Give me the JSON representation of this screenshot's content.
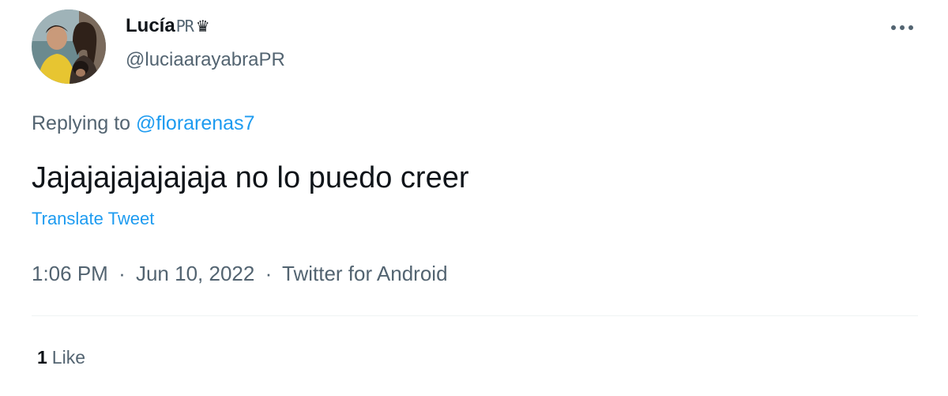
{
  "author": {
    "display_name": "Lucía",
    "name_suffix": "PR",
    "crown_glyph": "♛",
    "handle": "@luciaarayabraPR",
    "avatar_icon": "profile-photo"
  },
  "more_icon": "more-dots-icon",
  "reply": {
    "prefix": "Replying to",
    "mention": "@florarenas7"
  },
  "tweet_text": "Jajajajajajajaja no lo puedo creer",
  "translate_label": "Translate Tweet",
  "meta": {
    "time": "1:06 PM",
    "date": "Jun 10, 2022",
    "source": "Twitter for Android",
    "separator": "·"
  },
  "likes": {
    "count": "1",
    "label": "Like"
  },
  "colors": {
    "primary_text": "#0f1419",
    "secondary_text": "#536471",
    "link": "#1d9bf0",
    "divider": "#eff3f4"
  }
}
